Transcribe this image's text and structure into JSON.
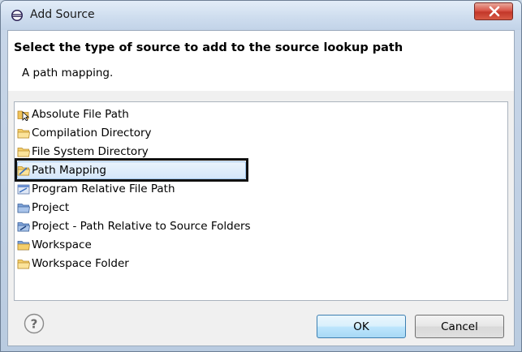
{
  "window": {
    "title": "Add Source",
    "close_icon": "close-icon",
    "accent_color": "#3c7fb1",
    "selection_color": "#d4e6f9"
  },
  "header": {
    "title": "Select the type of source to add to the source lookup path",
    "description": "A path mapping."
  },
  "source_types": [
    {
      "label": "Absolute File Path",
      "icon": "absolute-file-path-icon"
    },
    {
      "label": "Compilation Directory",
      "icon": "folder-icon"
    },
    {
      "label": "File System Directory",
      "icon": "folder-icon"
    },
    {
      "label": "Path Mapping",
      "icon": "path-mapping-icon",
      "selected": true
    },
    {
      "label": "Program Relative File Path",
      "icon": "program-relative-path-icon"
    },
    {
      "label": "Project",
      "icon": "project-folder-icon"
    },
    {
      "label": "Project - Path Relative to Source Folders",
      "icon": "project-relative-folder-icon"
    },
    {
      "label": "Workspace",
      "icon": "workspace-folder-icon"
    },
    {
      "label": "Workspace Folder",
      "icon": "folder-icon"
    }
  ],
  "footer": {
    "help_icon": "help-icon",
    "ok_label": "OK",
    "cancel_label": "Cancel"
  }
}
